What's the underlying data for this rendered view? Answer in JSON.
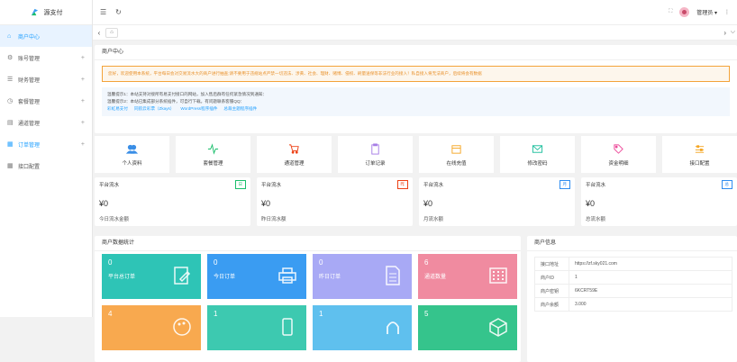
{
  "sidebar": {
    "brand": "源支付",
    "items": [
      {
        "label": "商户中心",
        "icon": "home-icon",
        "expandable": false
      },
      {
        "label": "账号管理",
        "icon": "settings-icon",
        "expandable": true
      },
      {
        "label": "财务管理",
        "icon": "list-icon",
        "expandable": true
      },
      {
        "label": "套餐管理",
        "icon": "clock-icon",
        "expandable": true
      },
      {
        "label": "通道管理",
        "icon": "layers-icon",
        "expandable": true
      },
      {
        "label": "订单管理",
        "icon": "order-icon",
        "expandable": true
      },
      {
        "label": "接口配置",
        "icon": "grid-icon",
        "expandable": false
      }
    ],
    "active_index": 0,
    "highlight_index": 5
  },
  "topbar": {
    "user": "管理员",
    "user_caret": "▾",
    "more": "⋮"
  },
  "tabs": {
    "prev": "‹",
    "next": "›",
    "dropdown": "⌵"
  },
  "page": {
    "title": "商户中心",
    "notice": "您好，欢迎使用本系统，平台每日会对交易流水大的商户进行抽查;请不要用于违规站点严禁一切违法、涉黄、社会、理财、赌博、侵权、刷量送保等非法行业的接入！私自接入将无法商户，后续将会有数据",
    "tip1": "温馨提示1：本站支持对接所有易支付接口的网站，加入售后群有任何紧急情况到通知：",
    "tip2": "温馨提示2：本站已集成部分系统插件，可自行下载。有问题联系客服QQ：",
    "links": [
      "彩虹易支付",
      "同航云彩票（Zkays）",
      "WordPress程序插件",
      "总裁主题程序插件"
    ]
  },
  "quick": [
    {
      "label": "个人资料",
      "icon": "users-icon",
      "color": "#3a8ee6"
    },
    {
      "label": "套餐管理",
      "icon": "pulse-icon",
      "color": "#19be6b"
    },
    {
      "label": "通道管理",
      "icon": "cart-icon",
      "color": "#ed4014"
    },
    {
      "label": "订单记录",
      "icon": "clipboard-icon",
      "color": "#a67ce6"
    },
    {
      "label": "在线充值",
      "icon": "calendar-icon",
      "color": "#f5a623"
    },
    {
      "label": "修改密码",
      "icon": "mail-icon",
      "color": "#19be9b"
    },
    {
      "label": "资金明细",
      "icon": "tag-icon",
      "color": "#ed4a9a"
    },
    {
      "label": "接口配置",
      "icon": "sliders-icon",
      "color": "#f5a623"
    }
  ],
  "stats": [
    {
      "title": "平台流水",
      "badge": "日",
      "badge_color": "#19be6b",
      "value": "¥0",
      "sub": "今日流水金额"
    },
    {
      "title": "平台流水",
      "badge": "昨",
      "badge_color": "#ed4014",
      "value": "¥0",
      "sub": "昨日流水额"
    },
    {
      "title": "平台流水",
      "badge": "月",
      "badge_color": "#2d8cf0",
      "value": "¥0",
      "sub": "月流水额"
    },
    {
      "title": "平台流水",
      "badge": "总",
      "badge_color": "#2d8cf0",
      "value": "¥0",
      "sub": "总流水额"
    }
  ],
  "merchant_stats": {
    "title": "商户数据统计",
    "tiles": [
      {
        "value": "0",
        "label": "平台总订单",
        "color": "#2ec4b6",
        "icon": "edit-doc-icon"
      },
      {
        "value": "0",
        "label": "今日订单",
        "color": "#3a9cf2",
        "icon": "printer-icon"
      },
      {
        "value": "0",
        "label": "昨日订单",
        "color": "#a8a9f5",
        "icon": "document-icon"
      },
      {
        "value": "6",
        "label": "通道数量",
        "color": "#f08ba0",
        "icon": "grid-dots-icon"
      },
      {
        "value": "4",
        "label": "",
        "color": "#f8a94f",
        "icon": "palette-icon"
      },
      {
        "value": "1",
        "label": "",
        "color": "#3dc9b0",
        "icon": "phone-icon"
      },
      {
        "value": "1",
        "label": "",
        "color": "#5fc0ee",
        "icon": "android-icon"
      },
      {
        "value": "5",
        "label": "",
        "color": "#35c48c",
        "icon": "cube-icon"
      }
    ]
  },
  "info": {
    "title": "商户信息",
    "rows": [
      {
        "k": "接口地址",
        "v": "https://zf.sky021.com"
      },
      {
        "k": "商户ID",
        "v": "1"
      },
      {
        "k": "商户密钥",
        "v": "6KCRT59E"
      },
      {
        "k": "商户余额",
        "v": "3.000"
      }
    ]
  }
}
